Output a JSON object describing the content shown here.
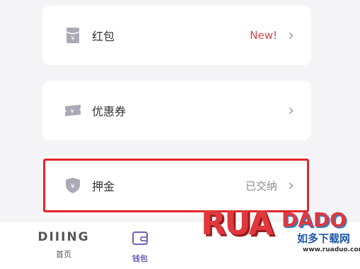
{
  "rows": [
    {
      "label": "红包",
      "right": "New!"
    },
    {
      "label": "优惠券",
      "right": ""
    },
    {
      "label": "押金",
      "right": "已交纳"
    }
  ],
  "tabs": [
    {
      "label": "首页",
      "logo": "DIIING"
    },
    {
      "label": "钱包"
    }
  ],
  "watermark": {
    "brand": "RUADADO",
    "rua": "RUA",
    "dado": "DADO",
    "cn": "如多下载网",
    "url": "www.ruaduo.com"
  },
  "colors": {
    "accent": "#7160b8",
    "highlight": "#e0262b",
    "new": "#d0454d"
  },
  "icons": {
    "row0": "red-envelope-icon",
    "row1": "coupon-ticket-icon",
    "row2": "shield-yen-icon",
    "tab0": "logo-wordmark",
    "tab1": "wallet-icon"
  }
}
